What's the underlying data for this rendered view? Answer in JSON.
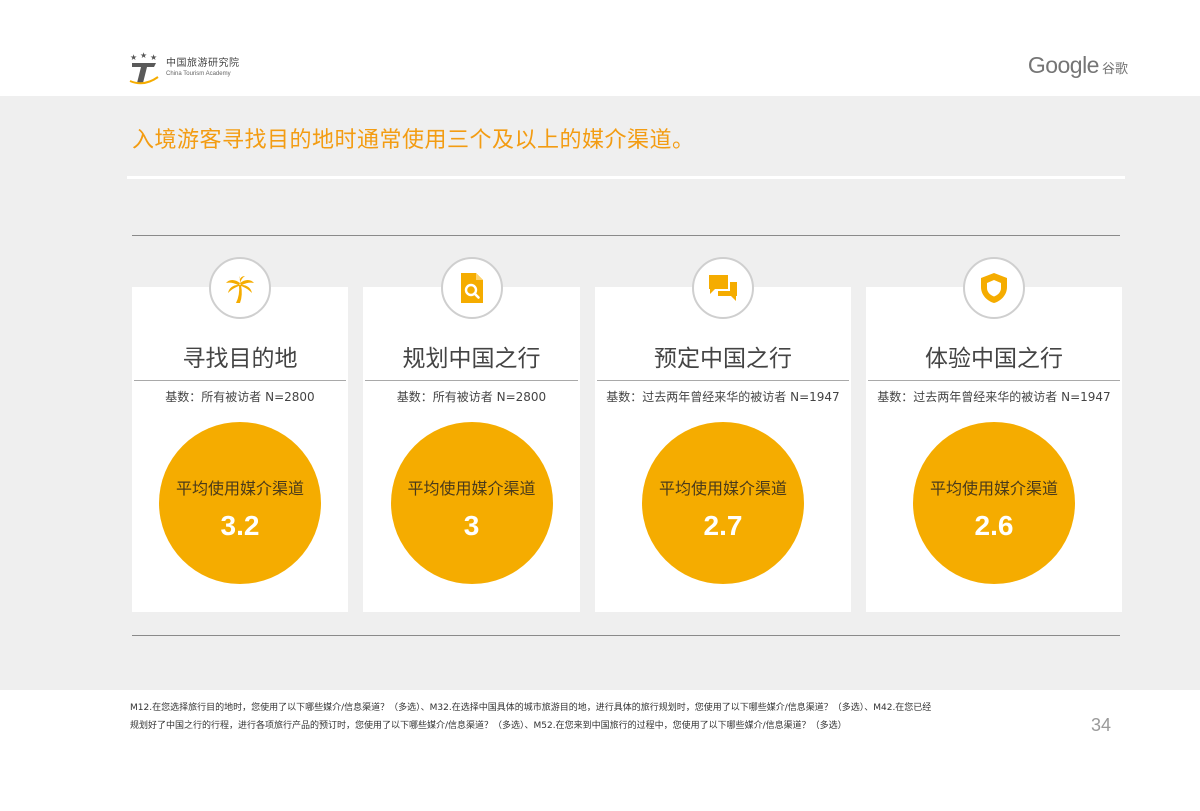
{
  "header": {
    "org_cn": "中国旅游研究院",
    "org_en": "China Tourism Academy",
    "brand_word": "Google",
    "brand_cn": "谷歌"
  },
  "title": "入境游客寻找目的地时通常使用三个及以上的媒介渠道。",
  "accent_color": "#f5ac00",
  "title_color": "#f39c12",
  "cards": [
    {
      "icon": "palm-tree-icon",
      "stage": "寻找目的地",
      "base": "基数：所有被访者 N=2800",
      "avg_label": "平均使用媒介渠道",
      "avg_value": "3.2"
    },
    {
      "icon": "document-search-icon",
      "stage": "规划中国之行",
      "base": "基数：所有被访者 N=2800",
      "avg_label": "平均使用媒介渠道",
      "avg_value": "3"
    },
    {
      "icon": "chat-bubbles-icon",
      "stage": "预定中国之行",
      "base": "基数：过去两年曾经来华的被访者 N=1947",
      "avg_label": "平均使用媒介渠道",
      "avg_value": "2.7"
    },
    {
      "icon": "shield-icon",
      "stage": "体验中国之行",
      "base": "基数：过去两年曾经来华的被访者 N=1947",
      "avg_label": "平均使用媒介渠道",
      "avg_value": "2.6"
    }
  ],
  "footnote": {
    "line1": "M12.在您选择旅行目的地时，您使用了以下哪些媒介/信息渠道？（多选）、M32.在选择中国具体的城市旅游目的地，进行具体的旅行规划时，您使用了以下哪些媒介/信息渠道？（多选）、M42.在您已经",
    "line2": "规划好了中国之行的行程，进行各项旅行产品的预订时，您使用了以下哪些媒介/信息渠道？（多选）、M52.在您来到中国旅行的过程中，您使用了以下哪些媒介/信息渠道？（多选）"
  },
  "page_number": "34"
}
